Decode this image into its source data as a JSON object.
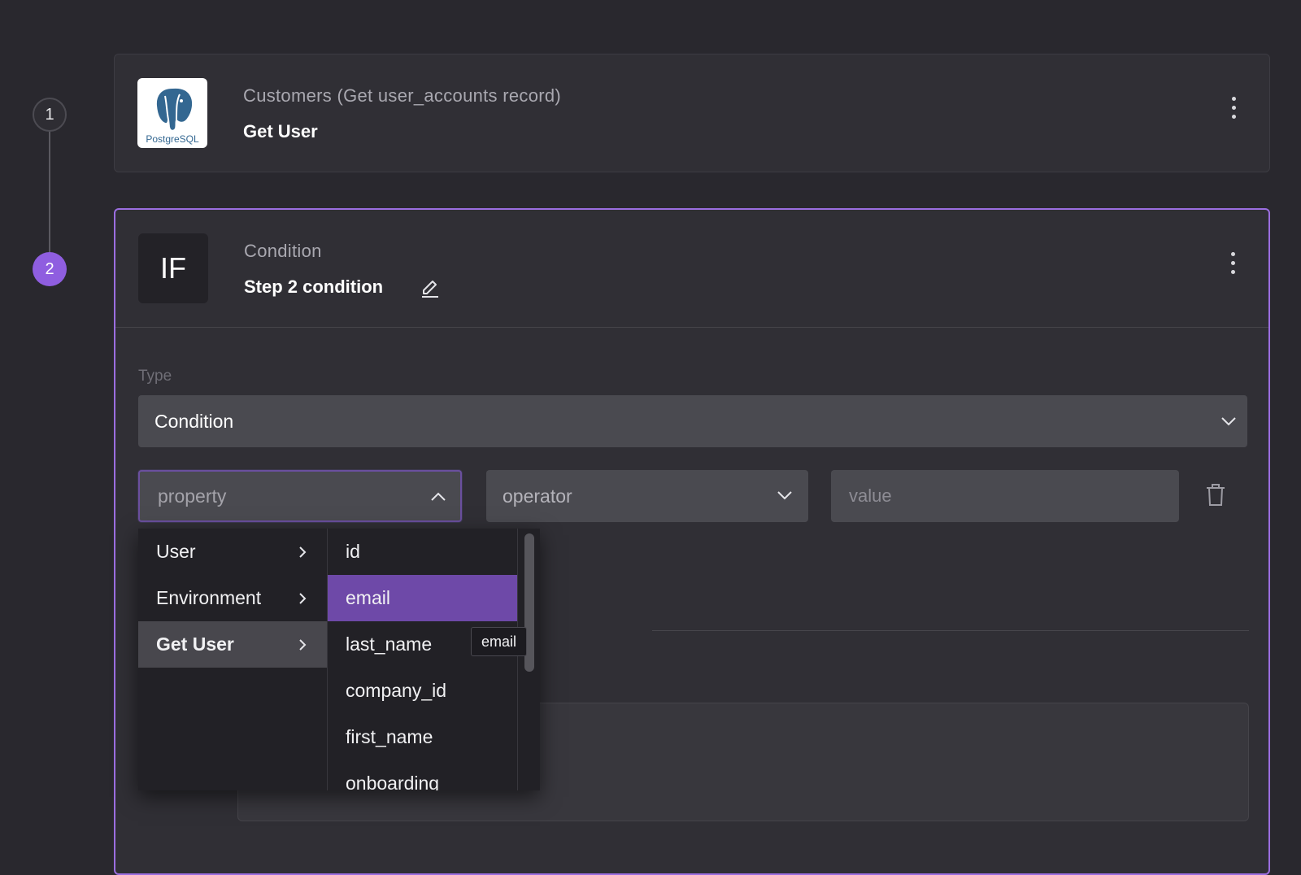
{
  "steps": [
    {
      "number": "1",
      "subtitle": "Customers (Get user_accounts record)",
      "title": "Get User",
      "logo_text": "PostgreSQL",
      "icon": "postgresql-elephant-icon"
    },
    {
      "number": "2",
      "subtitle": "Condition",
      "title": "Step 2 condition",
      "logo_text": "IF",
      "icon": "if-icon"
    }
  ],
  "condition_form": {
    "type_label": "Type",
    "type_value": "Condition",
    "property_placeholder": "property",
    "operator_placeholder": "operator",
    "value_placeholder": "value"
  },
  "dropdown": {
    "categories": [
      {
        "label": "User",
        "active": false
      },
      {
        "label": "Environment",
        "active": false
      },
      {
        "label": "Get User",
        "active": true
      }
    ],
    "fields": [
      {
        "label": "id",
        "active": false
      },
      {
        "label": "email",
        "active": true
      },
      {
        "label": "last_name",
        "active": false
      },
      {
        "label": "company_id",
        "active": false
      },
      {
        "label": "first_name",
        "active": false
      },
      {
        "label": "onboarding",
        "active": false
      }
    ],
    "tooltip": "email"
  },
  "colors": {
    "background": "#29282e",
    "card": "#302f35",
    "accent_purple": "#8f5ee0",
    "selected_item": "#6e49a8",
    "field": "#4a4a50"
  }
}
